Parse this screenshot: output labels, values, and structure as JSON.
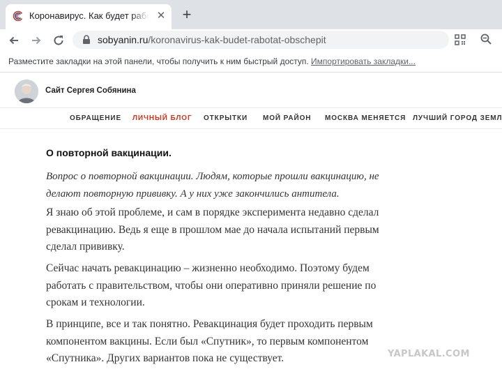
{
  "browser": {
    "tab": {
      "title": "Коронавирус. Как будет работать общепит",
      "close_icon": "close-icon"
    },
    "new_tab_icon": "plus-icon",
    "toolbar": {
      "back_icon": "arrow-left-icon",
      "forward_icon": "arrow-right-icon",
      "reload_icon": "reload-icon",
      "url_domain": "sobyanin.ru",
      "url_path": "/koronavirus-kak-budet-rabotat-obschepit",
      "qr_icon": "qr-code-icon",
      "zoom_icon": "zoom-icon"
    },
    "bookmarks_bar": {
      "text": "Разместите закладки на этой панели, чтобы получить к ним быстрый доступ. ",
      "import_link": "Импортировать закладки..."
    }
  },
  "site": {
    "title": "Сайт Сергея Собянина",
    "nav": [
      {
        "label": "ОБРАЩЕНИЕ",
        "active": false
      },
      {
        "label": "ЛИЧНЫЙ БЛОГ",
        "active": true
      },
      {
        "label": "ОТКРЫТКИ",
        "active": false
      },
      {
        "label": "МОЙ РАЙОН",
        "active": false
      },
      {
        "label": "МОСКВА МЕНЯЕТСЯ",
        "active": false
      },
      {
        "label": "ЛУЧШИЙ ГОРОД ЗЕМЛИ",
        "active": false
      }
    ],
    "accent_color": "#d2341e"
  },
  "article": {
    "heading": "О повторной вакцинации.",
    "question_line1": "Вопрос о повторной вакцинации. Людям, которые прошли вакцинацию, не",
    "question_line2": "делают повторную прививку. А у них уже закончились антитела.",
    "p1_line1": "Я знаю об этой проблеме, и сам в порядке эксперимента недавно сделал",
    "p1_line2": "ревакцинацию. Ведь я еще в прошлом мае до начала испытаний первым",
    "p1_line3": "сделал прививку.",
    "p2_line1": "Сейчас начать ревакцинацию – жизненно необходимо. Поэтому будем",
    "p2_line2": "работать с правительством, чтобы они оперативно приняли решение по",
    "p2_line3": "срокам и технологии.",
    "p3_line1": "В принципе, все и так понятно. Ревакцинация будет проходить первым",
    "p3_line2": "компонентом вакцины. Если был «Спутник», то первым компонентом",
    "p3_line3": "«Спутника». Других вариантов пока не существует."
  },
  "watermark": "YAPLAKAL.COM"
}
